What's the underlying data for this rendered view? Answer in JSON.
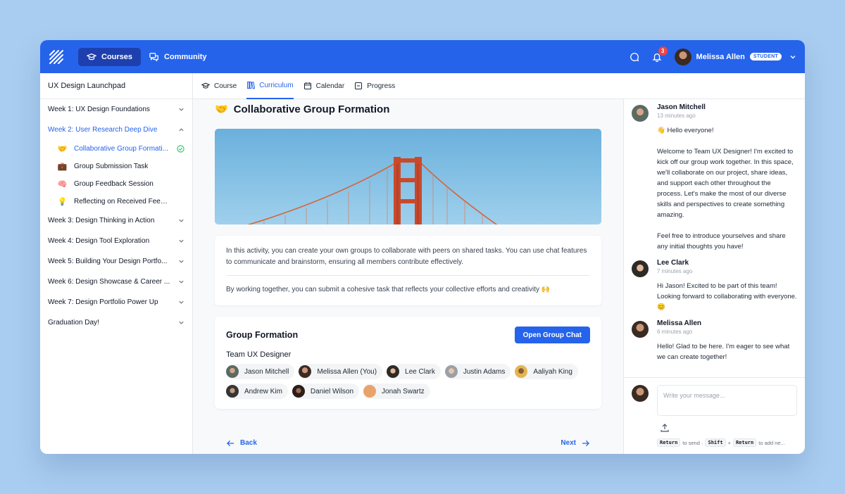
{
  "topbar": {
    "nav": [
      {
        "label": "Courses",
        "active": true
      },
      {
        "label": "Community",
        "active": false
      }
    ],
    "notification_count": "3",
    "user_name": "Melissa Allen",
    "user_role": "STUDENT"
  },
  "sidebar": {
    "course_title": "UX Design Launchpad",
    "weeks": [
      {
        "label": "Week 1: UX Design Foundations"
      },
      {
        "label": "Week 2: User Research Deep Dive"
      },
      {
        "label": "Week 3: Design Thinking in Action"
      },
      {
        "label": "Week 4: Design Tool Exploration"
      },
      {
        "label": "Week 5: Building Your Design Portfo..."
      },
      {
        "label": "Week 6: Design Showcase & Career ..."
      },
      {
        "label": "Week 7: Design Portfolio Power Up"
      },
      {
        "label": "Graduation Day!"
      }
    ],
    "lessons": [
      {
        "emoji": "🤝",
        "label": "Collaborative Group Formati...",
        "completed": true
      },
      {
        "emoji": "💼",
        "label": "Group Submission Task"
      },
      {
        "emoji": "🧠",
        "label": "Group Feedback Session"
      },
      {
        "emoji": "💡",
        "label": "Reflecting on Received Feedback"
      }
    ]
  },
  "tabs": [
    {
      "label": "Course",
      "icon": "graduation-cap-icon"
    },
    {
      "label": "Curriculum",
      "icon": "books-icon",
      "active": true
    },
    {
      "label": "Calendar",
      "icon": "calendar-icon"
    },
    {
      "label": "Progress",
      "icon": "progress-icon"
    }
  ],
  "activity": {
    "emoji": "🤝",
    "title": "Collaborative Group Formation",
    "description_1": "In this activity, you can create your own groups to collaborate with peers on shared tasks. You can use chat features to communicate and brainstorm, ensuring all members contribute effectively.",
    "description_2": "By working together, you can submit a cohesive task that reflects your collective efforts and creativity 🙌"
  },
  "group": {
    "title": "Group Formation",
    "open_chat_label": "Open Group Chat",
    "team_name": "Team UX Designer",
    "members": [
      {
        "name": "Jason Mitchell"
      },
      {
        "name": "Melissa Allen (You)"
      },
      {
        "name": "Lee Clark"
      },
      {
        "name": "Justin Adams"
      },
      {
        "name": "Aaliyah King"
      },
      {
        "name": "Andrew Kim"
      },
      {
        "name": "Daniel Wilson"
      },
      {
        "name": "Jonah Swartz"
      }
    ]
  },
  "pager": {
    "back": "Back",
    "next": "Next"
  },
  "chat": {
    "messages": [
      {
        "author": "Jason Mitchell",
        "time": "13 minutes ago",
        "text": "👋 Hello everyone!\n\nWelcome to Team UX Designer! I'm excited to kick off our group work together. In this space, we'll collaborate on our project, share ideas, and support each other throughout the process. Let's make the most of our diverse skills and perspectives to create something amazing.\n\nFeel free to introduce yourselves and share any initial thoughts you have!"
      },
      {
        "author": "Lee Clark",
        "time": "7 minutes ago",
        "text": "Hi Jason! Excited to be part of this team! Looking forward to collaborating with everyone. 😊"
      },
      {
        "author": "Melissa Allen",
        "time": "6 minutes ago",
        "text": "Hello! Glad to be here. I'm eager to see what we can create together!"
      }
    ],
    "placeholder": "Write your message...",
    "hint_key_1": "Return",
    "hint_text_1": "to send ·",
    "hint_key_2": "Shift",
    "hint_plus": "+",
    "hint_key_3": "Return",
    "hint_text_2": "to add ne..."
  }
}
